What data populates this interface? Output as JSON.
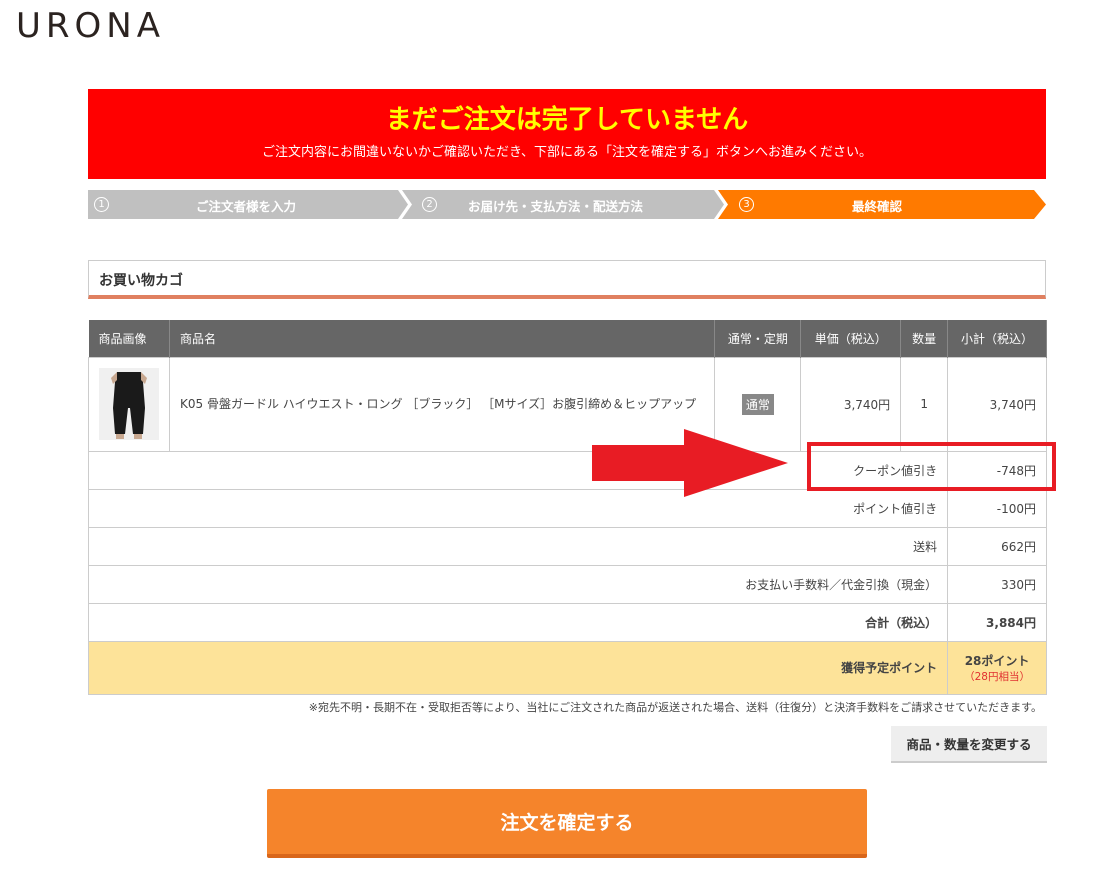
{
  "brand": "URONA",
  "alert": {
    "title": "まだご注文は完了していません",
    "subtitle": "ご注文内容にお間違いないかご確認いただき、下部にある「注文を確定する」ボタンへお進みください。"
  },
  "steps": [
    {
      "num": "1",
      "label": "ご注文者様を入力",
      "active": false
    },
    {
      "num": "2",
      "label": "お届け先・支払方法・配送方法",
      "active": false
    },
    {
      "num": "3",
      "label": "最終確認",
      "active": true
    }
  ],
  "cart": {
    "heading": "お買い物カゴ",
    "columns": [
      "商品画像",
      "商品名",
      "通常・定期",
      "単価（税込）",
      "数量",
      "小計（税込）"
    ],
    "item": {
      "name": "K05 骨盤ガードル ハイウエスト・ロング ［ブラック］ ［Mサイズ］お腹引締め＆ヒップアップ",
      "type": "通常",
      "unit_price": "3,740円",
      "qty": "1",
      "subtotal": "3,740円"
    },
    "summary": [
      {
        "label": "クーポン値引き",
        "value": "-748円"
      },
      {
        "label": "ポイント値引き",
        "value": "-100円"
      },
      {
        "label": "送料",
        "value": "662円"
      },
      {
        "label": "お支払い手数料／代金引換（現金）",
        "value": "330円"
      }
    ],
    "total": {
      "label": "合計（税込）",
      "value": "3,884円"
    },
    "points": {
      "label": "獲得予定ポイント",
      "value": "28ポイント",
      "sub": "（28円相当）"
    }
  },
  "note": "※宛先不明・長期不在・受取拒否等により、当社にご注文された商品が返送された場合、送料（往復分）と決済手数料をご請求させていただきます。",
  "buttons": {
    "change": "商品・数量を変更する",
    "confirm": "注文を確定する"
  },
  "colors": {
    "alert_bg": "#ff0000",
    "alert_title": "#ffff00",
    "step_inactive": "#c0c0c0",
    "step_active": "#ff7a00",
    "confirm_btn": "#f5842b",
    "annotation_red": "#e81c24"
  }
}
